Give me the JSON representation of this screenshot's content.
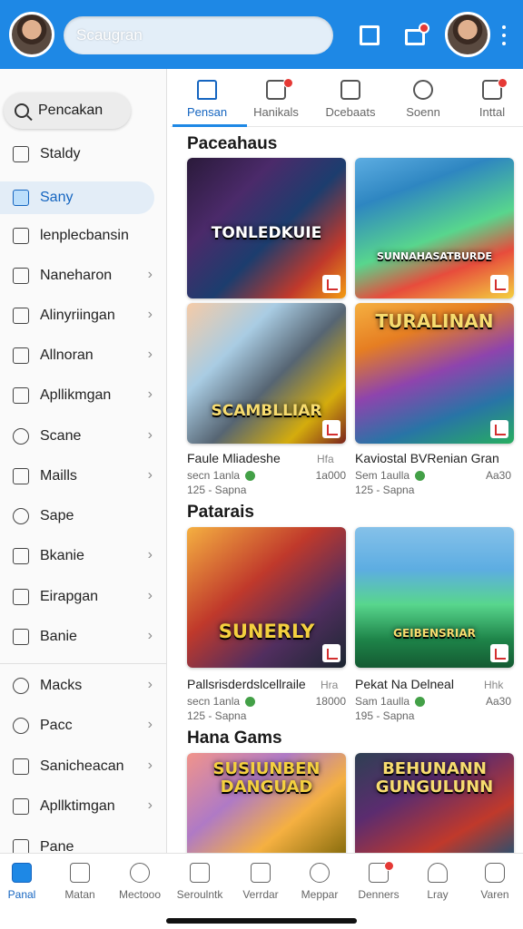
{
  "topbar": {
    "search_placeholder": "Scaugran"
  },
  "sidebar": {
    "search_label": "Pencakan",
    "items": [
      {
        "label": "Staldy"
      },
      {
        "label": "Sany"
      },
      {
        "label": "lenplecbansin"
      },
      {
        "label": "Naneharon"
      },
      {
        "label": "Alinyriingan"
      },
      {
        "label": "Allnoran"
      },
      {
        "label": "Apllikmgan"
      },
      {
        "label": "Scane"
      },
      {
        "label": "Maills"
      },
      {
        "label": "Sape"
      },
      {
        "label": "Bkanie"
      },
      {
        "label": "Eirapgan"
      },
      {
        "label": "Banie"
      },
      {
        "label": "Macks"
      },
      {
        "label": "Pacc"
      },
      {
        "label": "Sanicheacan"
      },
      {
        "label": "Apllktimgan"
      },
      {
        "label": "Pane"
      }
    ]
  },
  "tabs": [
    {
      "label": "Pensan"
    },
    {
      "label": "Hanikals"
    },
    {
      "label": "Dcebaats"
    },
    {
      "label": "Soenn"
    },
    {
      "label": "Inttal"
    }
  ],
  "sections": [
    {
      "title": "Paceahaus"
    },
    {
      "title": "Patarais"
    },
    {
      "title": "Hana Gams"
    }
  ],
  "cards": [
    {
      "art_title": "TONLEDKUIE"
    },
    {
      "art_title": "SUNNAHASATBURDE"
    },
    {
      "art_title": "SCAMBLLIAR",
      "name": "Faule Mliadeshe",
      "side": "Hfa",
      "sub_left": "secn 1anla",
      "sub_right": "1a000",
      "count": "125 - Sapna"
    },
    {
      "art_title": "TURALINAN",
      "name": "Kaviostal BVRenian Gran",
      "side": "",
      "sub_left": "Sem 1aulla",
      "sub_right": "Aa30",
      "count": "125 - Sapna"
    },
    {
      "art_title": "SUNERLY",
      "name": "Pallsrisderdslcellraile",
      "side": "Hra",
      "sub_left": "secn 1anla",
      "sub_right": "18000",
      "count": "125 - Sapna"
    },
    {
      "art_title": "GEIBENSRIAR",
      "name": "Pekat Na Delneal",
      "side": "Hhk",
      "sub_left": "Sam 1aulla",
      "sub_right": "Aa30",
      "count": "195 - Sapna"
    },
    {
      "art_title": "SUSIUNBEN DANGUAD"
    },
    {
      "art_title": "BEHUNANN GUNGULUNN"
    }
  ],
  "bottom_nav": [
    {
      "label": "Panal"
    },
    {
      "label": "Matan"
    },
    {
      "label": "Mectooo"
    },
    {
      "label": "Seroulntk"
    },
    {
      "label": "Verrdar"
    },
    {
      "label": "Meppar"
    },
    {
      "label": "Denners"
    },
    {
      "label": "Lray"
    },
    {
      "label": "Varen"
    }
  ],
  "colors": {
    "accent": "#1e88e5",
    "badge": "#e53935",
    "active_bg": "#e3edf7"
  }
}
